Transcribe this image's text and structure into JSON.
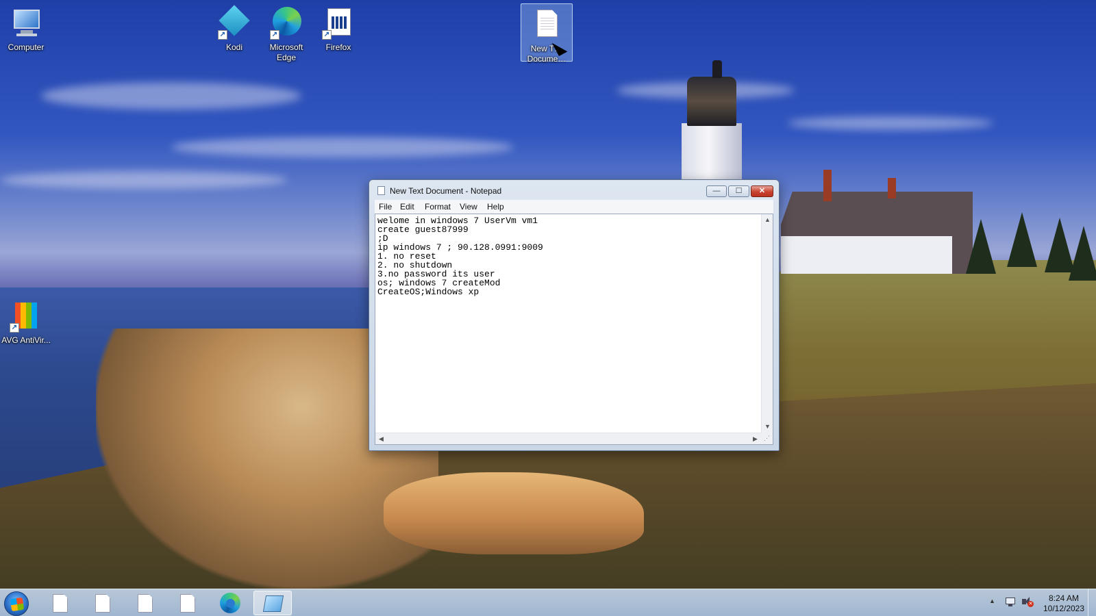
{
  "desktop": {
    "icons": [
      {
        "label": "Computer",
        "icon": "computer-icon"
      },
      {
        "label": "Kodi",
        "icon": "kodi-icon"
      },
      {
        "label": "Microsoft Edge",
        "icon": "edge-icon"
      },
      {
        "label": "Firefox",
        "icon": "firefox-icon"
      },
      {
        "label": "New T… Docume…",
        "icon": "text-document-icon",
        "selected": true
      },
      {
        "label": "AVG AntiVir...",
        "icon": "avg-antivirus-icon"
      }
    ]
  },
  "notepad": {
    "title": "New Text Document - Notepad",
    "controls": {
      "minimize": "—",
      "maximize": "☐",
      "close": "✕"
    },
    "menu": [
      "File",
      "Edit",
      "Format",
      "View",
      "Help"
    ],
    "content": "welome in windows 7 UserVm vm1\ncreate guest87999\n;D\nip windows 7 ; 90.128.0991:9009\n1. no reset\n2. no shutdown\n3.no password its user\nos; windows 7 createMod\nCreateOS;Windows xp",
    "scroll": {
      "up": "▲",
      "down": "▼",
      "left": "◀",
      "right": "▶",
      "grip": "⋰"
    }
  },
  "taskbar": {
    "start": "windows-start-icon",
    "buttons": [
      {
        "icon": "document-icon"
      },
      {
        "icon": "document-icon"
      },
      {
        "icon": "document-icon"
      },
      {
        "icon": "document-icon"
      },
      {
        "icon": "edge-icon"
      },
      {
        "icon": "notepad-icon",
        "active": true
      }
    ],
    "tray": {
      "arrow": "▲",
      "network": "network-icon",
      "volume": "volume-muted-icon"
    },
    "clock": {
      "time": "8:24 AM",
      "date": "10/12/2023"
    }
  },
  "colors": {
    "accent": "#1a5fb4",
    "close_button": "#c8432f"
  }
}
